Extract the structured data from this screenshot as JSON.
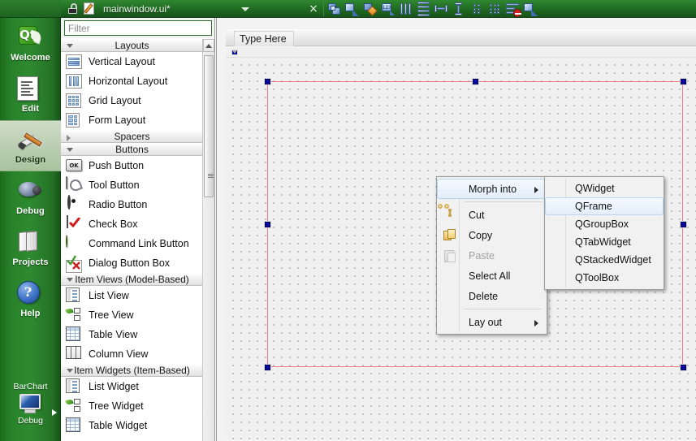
{
  "window": {
    "filename": "mainwindow.ui*"
  },
  "modebar": {
    "items": [
      {
        "label": "Welcome",
        "icon": "qt-logo-icon",
        "active": false
      },
      {
        "label": "Edit",
        "icon": "document-icon",
        "active": false
      },
      {
        "label": "Design",
        "icon": "paintbrush-icon",
        "active": true
      },
      {
        "label": "Debug",
        "icon": "bug-icon",
        "active": false
      },
      {
        "label": "Projects",
        "icon": "folders-icon",
        "active": false
      },
      {
        "label": "Help",
        "icon": "question-circle-icon",
        "active": false
      }
    ],
    "run_target": {
      "project": "BarChart",
      "config": "Debug",
      "icon": "monitor-icon"
    }
  },
  "toolbar": {
    "close_label": "×",
    "buttons": [
      {
        "name": "edit-widgets-icon",
        "title": "Edit Widgets"
      },
      {
        "name": "edit-signals-slots-icon",
        "title": "Edit Signals/Slots"
      },
      {
        "name": "edit-buddies-icon",
        "title": "Edit Buddies"
      },
      {
        "name": "edit-tab-order-icon",
        "title": "Edit Tab Order"
      },
      {
        "name": "layout-horizontally-icon",
        "title": "Lay Out Horizontally"
      },
      {
        "name": "layout-vertically-icon",
        "title": "Lay Out Vertically"
      },
      {
        "name": "layout-h-splitter-icon",
        "title": "Lay Out Horizontally in Splitter"
      },
      {
        "name": "layout-v-splitter-icon",
        "title": "Lay Out Vertically in Splitter"
      },
      {
        "name": "layout-form-icon",
        "title": "Lay Out in a Form Layout"
      },
      {
        "name": "layout-grid-icon",
        "title": "Lay Out in a Grid"
      },
      {
        "name": "break-layout-icon",
        "title": "Break Layout"
      },
      {
        "name": "adjust-size-icon",
        "title": "Adjust Size"
      }
    ]
  },
  "widgetbox": {
    "filter_placeholder": "Filter",
    "filter_value": "",
    "groups": [
      {
        "name": "Layouts",
        "expanded": true,
        "items": [
          {
            "label": "Vertical Layout",
            "icon": "vertical-layout-icon"
          },
          {
            "label": "Horizontal Layout",
            "icon": "horizontal-layout-icon"
          },
          {
            "label": "Grid Layout",
            "icon": "grid-layout-icon"
          },
          {
            "label": "Form Layout",
            "icon": "form-layout-icon"
          }
        ]
      },
      {
        "name": "Spacers",
        "expanded": false,
        "items": []
      },
      {
        "name": "Buttons",
        "expanded": true,
        "items": [
          {
            "label": "Push Button",
            "icon": "push-button-icon"
          },
          {
            "label": "Tool Button",
            "icon": "tool-button-icon"
          },
          {
            "label": "Radio Button",
            "icon": "radio-button-icon"
          },
          {
            "label": "Check Box",
            "icon": "check-box-icon"
          },
          {
            "label": "Command Link Button",
            "icon": "command-link-icon"
          },
          {
            "label": "Dialog Button Box",
            "icon": "dialog-button-box-icon"
          }
        ]
      },
      {
        "name": "Item Views (Model-Based)",
        "expanded": true,
        "items": [
          {
            "label": "List View",
            "icon": "list-view-icon"
          },
          {
            "label": "Tree View",
            "icon": "tree-view-icon"
          },
          {
            "label": "Table View",
            "icon": "table-view-icon"
          },
          {
            "label": "Column View",
            "icon": "column-view-icon"
          }
        ]
      },
      {
        "name": "Item Widgets (Item-Based)",
        "expanded": true,
        "items": [
          {
            "label": "List Widget",
            "icon": "list-widget-icon"
          },
          {
            "label": "Tree Widget",
            "icon": "tree-widget-icon"
          },
          {
            "label": "Table Widget",
            "icon": "table-widget-icon"
          }
        ]
      }
    ]
  },
  "canvas": {
    "menubar_placeholder": "Type Here"
  },
  "context_menu": {
    "items": [
      {
        "label": "Morph into",
        "icon": null,
        "submenu": true,
        "selected": true,
        "disabled": false
      },
      {
        "separator": true
      },
      {
        "label": "Cut",
        "icon": "scissors-icon",
        "submenu": false,
        "selected": false,
        "disabled": false
      },
      {
        "label": "Copy",
        "icon": "copy-icon",
        "submenu": false,
        "selected": false,
        "disabled": false
      },
      {
        "label": "Paste",
        "icon": "paste-icon",
        "submenu": false,
        "selected": false,
        "disabled": true
      },
      {
        "label": "Select All",
        "icon": null,
        "submenu": false,
        "selected": false,
        "disabled": false
      },
      {
        "label": "Delete",
        "icon": null,
        "submenu": false,
        "selected": false,
        "disabled": false
      },
      {
        "separator": true
      },
      {
        "label": "Lay out",
        "icon": null,
        "submenu": true,
        "selected": false,
        "disabled": false
      }
    ]
  },
  "submenu": {
    "items": [
      {
        "label": "QWidget",
        "selected": false
      },
      {
        "label": "QFrame",
        "selected": true
      },
      {
        "label": "QGroupBox",
        "selected": false
      },
      {
        "label": "QTabWidget",
        "selected": false
      },
      {
        "label": "QStackedWidget",
        "selected": false
      },
      {
        "label": "QToolBox",
        "selected": false
      }
    ]
  },
  "colors": {
    "mode_bar_green": "#2e8b30",
    "selection_red": "#e87b82",
    "handle_blue": "#0b0b9b",
    "menu_highlight": "#e3eefb",
    "menu_bg": "#f1f1f1"
  }
}
